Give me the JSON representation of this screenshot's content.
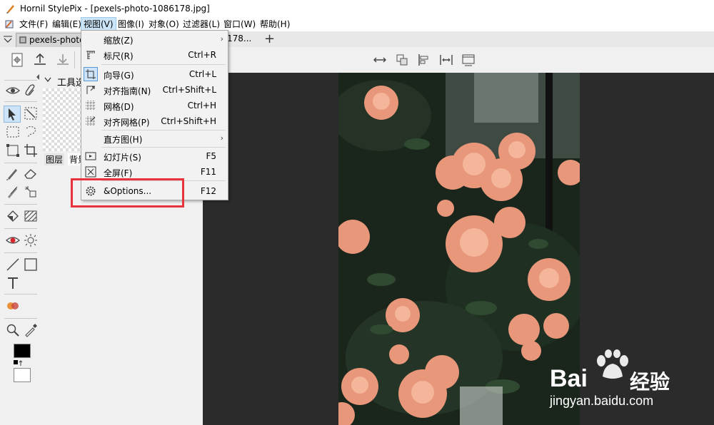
{
  "window": {
    "title": "Hornil StylePix - [pexels-photo-1086178.jpg]"
  },
  "menubar": {
    "items": [
      {
        "label": "文件(F)"
      },
      {
        "label": "编辑(E)"
      },
      {
        "label": "视图(V)"
      },
      {
        "label": "图像(I)"
      },
      {
        "label": "对象(O)"
      },
      {
        "label": "过滤器(L)"
      },
      {
        "label": "窗口(W)"
      },
      {
        "label": "帮助(H)"
      }
    ]
  },
  "tabs": {
    "doc1": "pexels-photo",
    "doc2": "178...",
    "add": "+"
  },
  "panel": {
    "title": "工具选",
    "tab_layers": "图层",
    "tab_bg": "背景"
  },
  "view_menu": {
    "items": [
      {
        "label": "缩放(Z)",
        "shortcut": "",
        "icon": "",
        "submenu": true
      },
      {
        "label": "标尺(R)",
        "shortcut": "Ctrl+R",
        "icon": "ruler-icon"
      },
      {
        "label": "向导(G)",
        "shortcut": "Ctrl+L",
        "icon": "guide-icon"
      },
      {
        "label": "对齐指南(N)",
        "shortcut": "Ctrl+Shift+L",
        "icon": "snap-guide-icon"
      },
      {
        "label": "网格(D)",
        "shortcut": "Ctrl+H",
        "icon": "grid-icon"
      },
      {
        "label": "对齐网格(P)",
        "shortcut": "Ctrl+Shift+H",
        "icon": "snap-grid-icon"
      },
      {
        "label": "直方图(H)",
        "shortcut": "",
        "icon": "",
        "submenu": true
      },
      {
        "label": "幻灯片(S)",
        "shortcut": "F5",
        "icon": "slideshow-icon"
      },
      {
        "label": "全屏(F)",
        "shortcut": "F11",
        "icon": "fullscreen-icon"
      },
      {
        "label": "&Options...",
        "shortcut": "F12",
        "icon": "gear-icon"
      }
    ]
  },
  "watermark": {
    "brand": "Bai",
    "brand2": "经验",
    "url": "jingyan.baidu.com"
  },
  "colors": {
    "highlight": "#e8323c",
    "menu_active": "#cce4f7",
    "canvas_bg": "#2b2b2b"
  }
}
